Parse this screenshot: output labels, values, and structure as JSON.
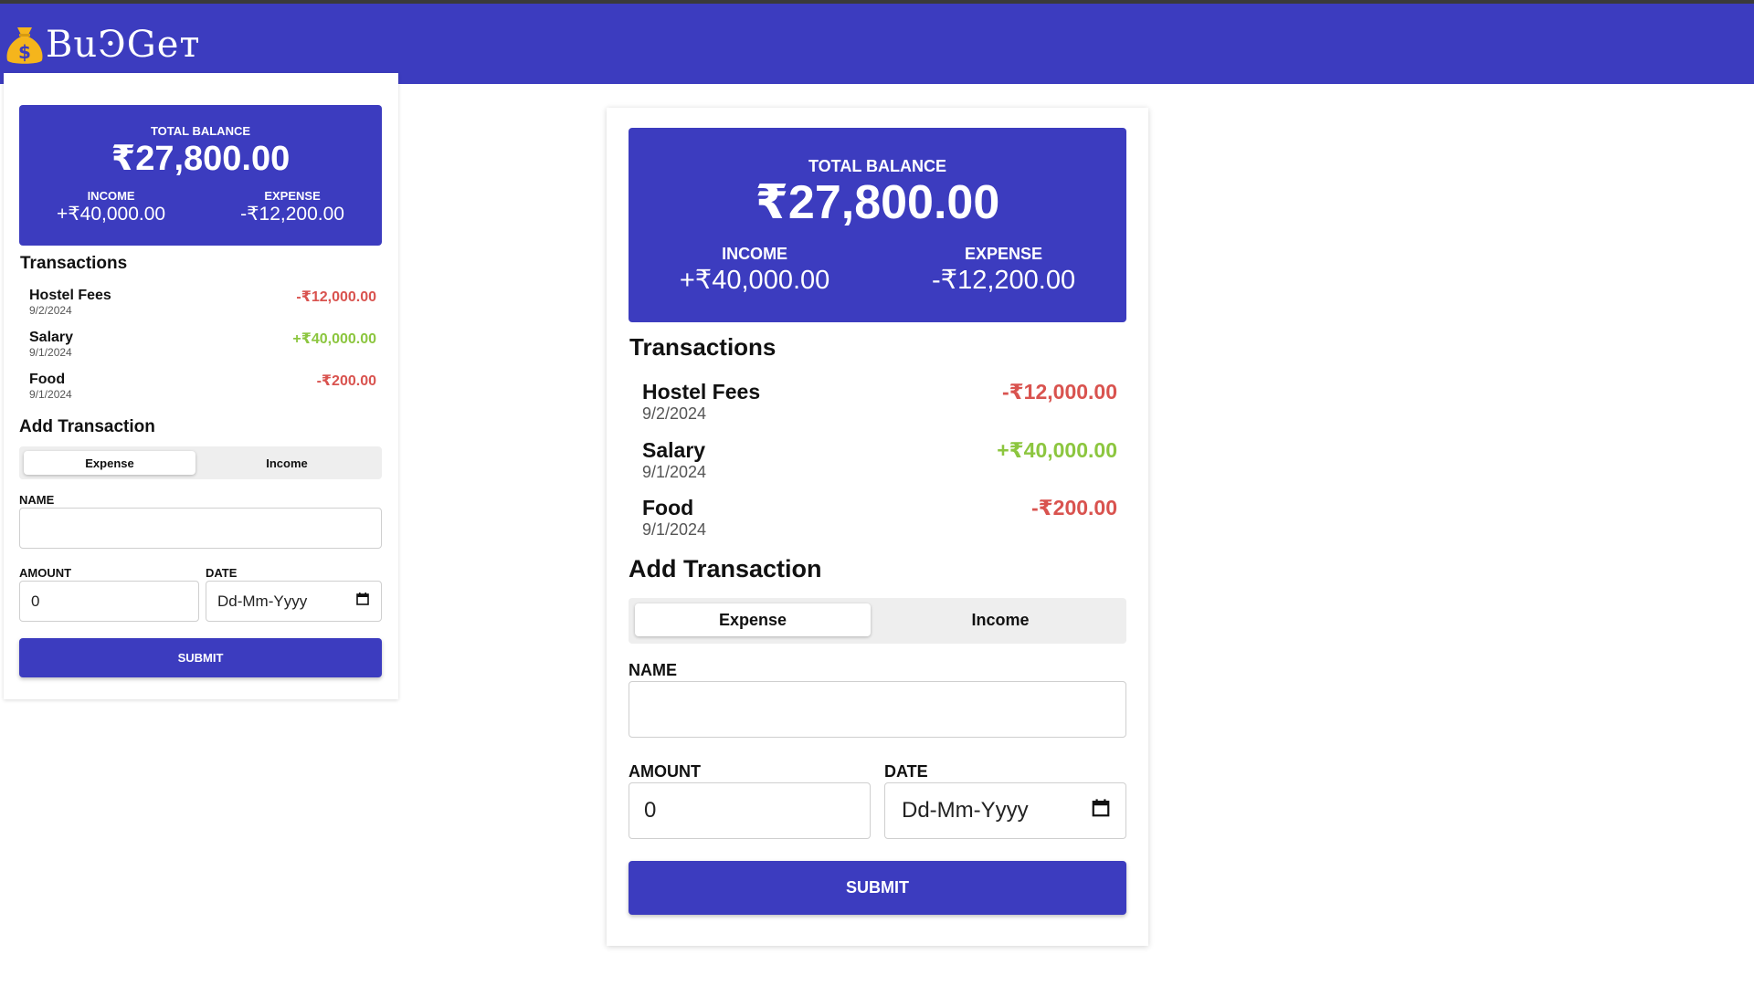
{
  "header": {
    "logo_text": "BuϿGeт"
  },
  "summary": {
    "total_label": "TOTAL BALANCE",
    "total_value": "₹27,800.00",
    "income_label": "INCOME",
    "income_value": "+₹40,000.00",
    "expense_label": "EXPENSE",
    "expense_value": "-₹12,200.00"
  },
  "transactions": {
    "title": "Transactions",
    "items": [
      {
        "name": "Hostel Fees",
        "date": "9/2/2024",
        "amount": "-₹12,000.00",
        "type": "expense"
      },
      {
        "name": "Salary",
        "date": "9/1/2024",
        "amount": "+₹40,000.00",
        "type": "income"
      },
      {
        "name": "Food",
        "date": "9/1/2024",
        "amount": "-₹200.00",
        "type": "expense"
      }
    ]
  },
  "form": {
    "title": "Add Transaction",
    "toggle": {
      "expense_label": "Expense",
      "income_label": "Income",
      "selected": "Expense"
    },
    "name_label": "NAME",
    "name_value": "",
    "amount_label": "AMOUNT",
    "amount_value": "0",
    "date_label": "DATE",
    "date_placeholder": "Dd-Mm-Yyyy",
    "submit_label": "SUBMIT"
  },
  "colors": {
    "brand": "#3c3cbf",
    "expense": "#d9534f",
    "income": "#8cc63f",
    "logo_bag": "#f5b51c"
  },
  "icons": {
    "logo": "money-bag-icon",
    "date_picker": "calendar-icon"
  }
}
